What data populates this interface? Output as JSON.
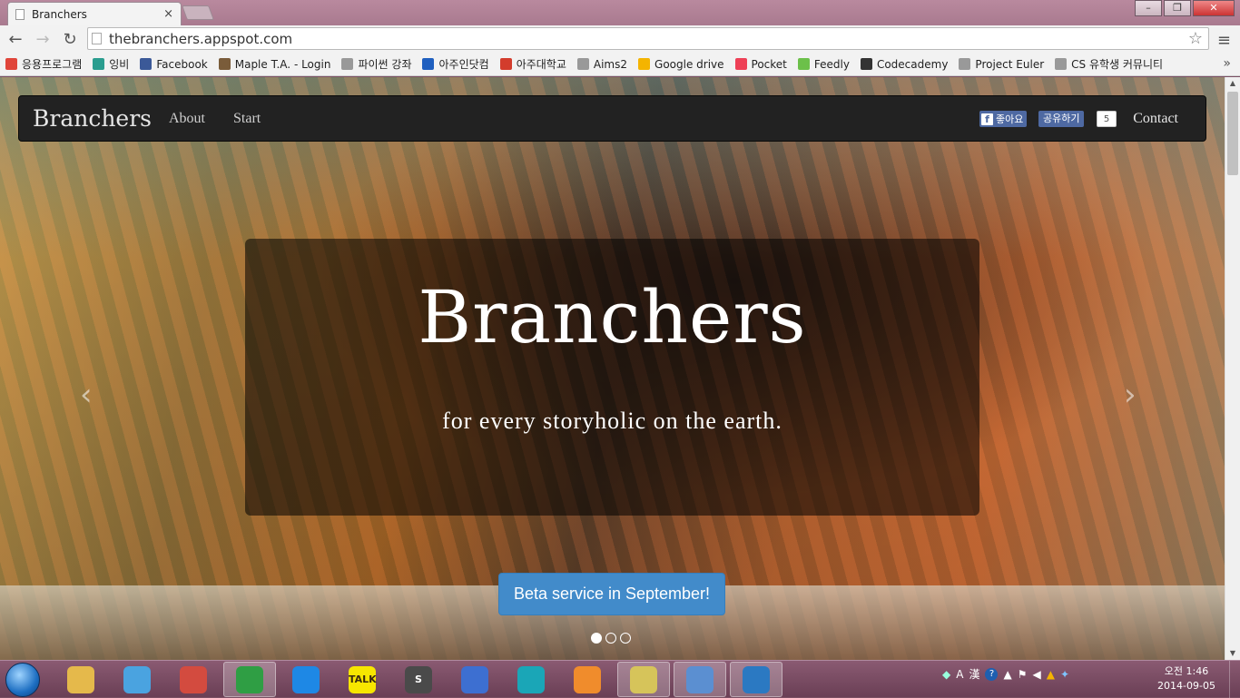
{
  "browser": {
    "tab_title": "Branchers",
    "tab_close": "×",
    "url": "thebranchers.appspot.com",
    "win_minimize": "–",
    "win_maximize": "❐",
    "win_close": "✕",
    "back": "←",
    "forward": "→",
    "reload": "↻",
    "star": "☆",
    "menu": "≡"
  },
  "bookmarks": [
    {
      "label": "응용프로그램",
      "icon": "apps-icon",
      "color": "#e0453a"
    },
    {
      "label": "잉비",
      "icon": "leaf-icon",
      "color": "#2a9d8f"
    },
    {
      "label": "Facebook",
      "icon": "facebook-icon",
      "color": "#3b5998"
    },
    {
      "label": "Maple T.A. - Login",
      "icon": "maple-icon",
      "color": "#7a5c3a"
    },
    {
      "label": "파이썬 강좌",
      "icon": "page-icon",
      "color": "#999999"
    },
    {
      "label": "아주인닷컴",
      "icon": "ajou-icon",
      "color": "#1f5fbf"
    },
    {
      "label": "아주대학교",
      "icon": "univ-icon",
      "color": "#d33c2c"
    },
    {
      "label": "Aims2",
      "icon": "page-icon",
      "color": "#999999"
    },
    {
      "label": "Google drive",
      "icon": "drive-icon",
      "color": "#f4b400"
    },
    {
      "label": "Pocket",
      "icon": "pocket-icon",
      "color": "#ee4056"
    },
    {
      "label": "Feedly",
      "icon": "feedly-icon",
      "color": "#6cc04a"
    },
    {
      "label": "Codecademy",
      "icon": "codecademy-icon",
      "color": "#333333"
    },
    {
      "label": "Project Euler",
      "icon": "page-icon",
      "color": "#999999"
    },
    {
      "label": "CS 유학생 커뮤니티",
      "icon": "page-icon",
      "color": "#999999"
    }
  ],
  "bookmarks_more": "»",
  "site": {
    "brand": "Branchers",
    "nav": [
      "About",
      "Start"
    ],
    "fb_like": "좋아요",
    "fb_share": "공유하기",
    "fb_count": "5",
    "contact": "Contact",
    "hero_title": "Branchers",
    "hero_subtitle": "for every storyholic on the earth.",
    "cta": "Beta service in September!",
    "prev": "‹",
    "next": "›",
    "slides": 3,
    "active_slide": 1
  },
  "taskbar": {
    "apps": [
      {
        "name": "explorer",
        "icon": "folder-icon",
        "color": "#e5b94b",
        "active": false
      },
      {
        "name": "itunes",
        "icon": "itunes-icon",
        "color": "#4aa3e0",
        "active": false
      },
      {
        "name": "clock-app",
        "icon": "compass-icon",
        "color": "#d34b3f",
        "active": false
      },
      {
        "name": "chrome",
        "icon": "chrome-icon",
        "color": "#2f9e44",
        "active": true
      },
      {
        "name": "ie",
        "icon": "ie-icon",
        "color": "#1e88e5",
        "active": false
      },
      {
        "name": "kakaotalk",
        "icon": "kakaotalk-icon",
        "color": "#f7e600",
        "active": false,
        "text": "TALK"
      },
      {
        "name": "sublime",
        "icon": "sublime-icon",
        "color": "#4a4a4a",
        "active": false,
        "text": "S"
      },
      {
        "name": "network-app",
        "icon": "network-icon",
        "color": "#3d6fd1",
        "active": false
      },
      {
        "name": "sourcetree",
        "icon": "tree-icon",
        "color": "#1aa6b7",
        "active": false
      },
      {
        "name": "app-orange",
        "icon": "swirl-icon",
        "color": "#f08c2c",
        "active": false
      },
      {
        "name": "notes",
        "icon": "notes-icon",
        "color": "#d6c45a",
        "active": true
      },
      {
        "name": "remote",
        "icon": "remote-icon",
        "color": "#5b8fd1",
        "active": true
      },
      {
        "name": "editor",
        "icon": "edit-icon",
        "color": "#2b79c2",
        "active": true
      }
    ],
    "tray_ime": "A",
    "tray_hanja": "漢",
    "tray_help": "?",
    "clock_ampm_time": "오전 1:46",
    "clock_date": "2014-09-05"
  }
}
